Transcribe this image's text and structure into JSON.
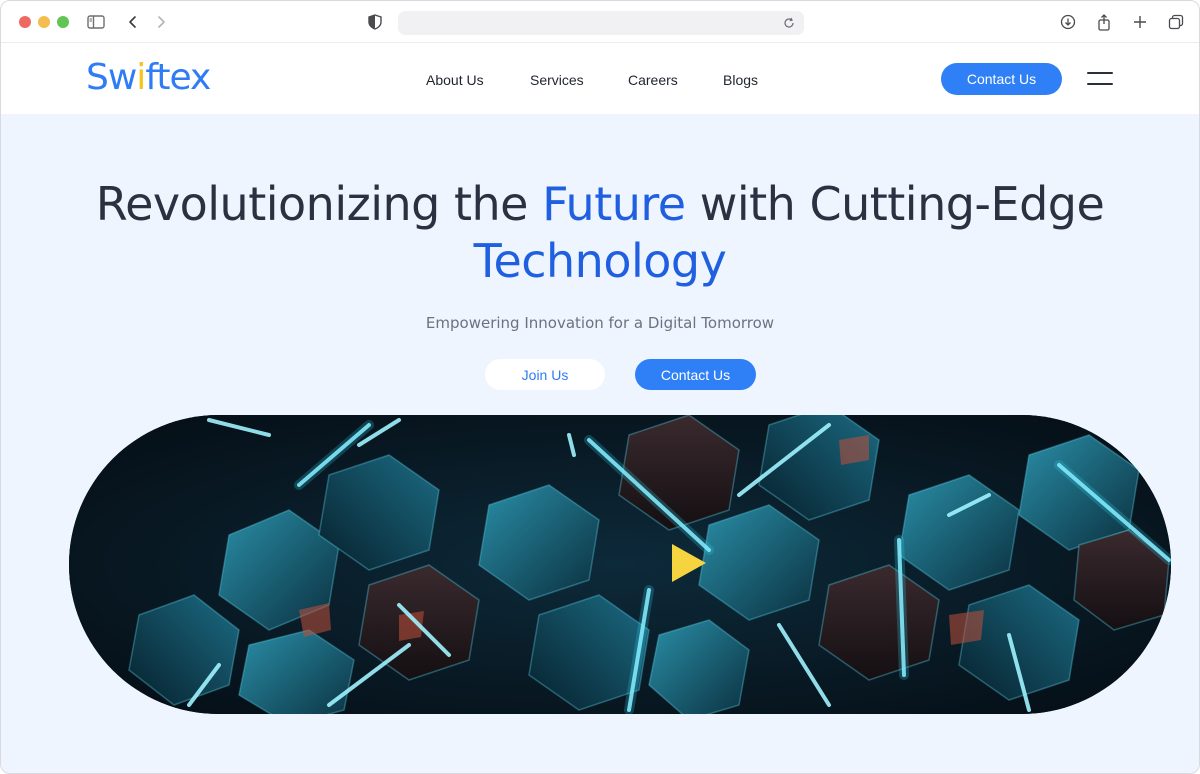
{
  "browser": {
    "traffic_colors": [
      "#ee6a5f",
      "#f5bd4f",
      "#61c554"
    ],
    "icons": [
      "sidebar-icon",
      "back-icon",
      "forward-icon",
      "shield-icon",
      "reload-icon",
      "download-icon",
      "share-icon",
      "new-tab-icon",
      "tabs-overview-icon"
    ]
  },
  "header": {
    "logo": {
      "prefix": "Sw",
      "accent": "i",
      "suffix": "ftex"
    },
    "nav": [
      "About Us",
      "Services",
      "Careers",
      "Blogs"
    ],
    "contact_label": "Contact Us",
    "menu_icon": "hamburger-menu-icon"
  },
  "hero": {
    "title_part1": "Revolutionizing the ",
    "title_highlight1": "Future",
    "title_part2": " with Cutting-Edge",
    "title_highlight2": "Technology",
    "subtitle": "Empowering Innovation for a Digital Tomorrow",
    "join_label": "Join Us",
    "contact_label": "Contact Us",
    "video_icon": "play-icon"
  },
  "colors": {
    "brand_blue": "#2f80f7",
    "highlight_blue": "#1f5fe0",
    "hero_background": "#eef5ff",
    "play_yellow": "#f5d440",
    "logo_accent": "#f5c518"
  }
}
